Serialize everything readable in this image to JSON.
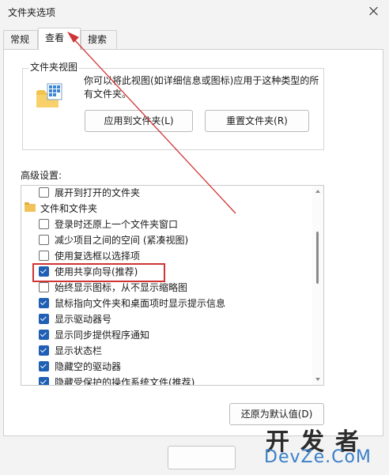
{
  "window": {
    "title": "文件夹选项"
  },
  "tabs": [
    {
      "label": "常规",
      "selected": false
    },
    {
      "label": "查看",
      "selected": true
    },
    {
      "label": "搜索",
      "selected": false
    }
  ],
  "folder_views": {
    "label": "文件夹视图",
    "description": "你可以将此视图(如详细信息或图标)应用于这种类型的所有文件夹。",
    "apply_button": "应用到文件夹(L)",
    "reset_button": "重置文件夹(R)"
  },
  "advanced": {
    "label": "高级设置:",
    "items": [
      {
        "label": "展开到打开的文件夹",
        "type": "checkbox",
        "checked": false
      },
      {
        "label": "文件和文件夹",
        "type": "category"
      },
      {
        "label": "登录时还原上一个文件夹窗口",
        "type": "checkbox",
        "checked": false
      },
      {
        "label": "减少项目之间的空间 (紧凑视图)",
        "type": "checkbox",
        "checked": false
      },
      {
        "label": "使用复选框以选择项",
        "type": "checkbox",
        "checked": false
      },
      {
        "label": "使用共享向导(推荐)",
        "type": "checkbox",
        "checked": true,
        "highlighted": true
      },
      {
        "label": "始终显示图标，从不显示缩略图",
        "type": "checkbox",
        "checked": false
      },
      {
        "label": "鼠标指向文件夹和桌面项时显示提示信息",
        "type": "checkbox",
        "checked": true
      },
      {
        "label": "显示驱动器号",
        "type": "checkbox",
        "checked": true
      },
      {
        "label": "显示同步提供程序通知",
        "type": "checkbox",
        "checked": true
      },
      {
        "label": "显示状态栏",
        "type": "checkbox",
        "checked": true
      },
      {
        "label": "隐藏空的驱动器",
        "type": "checkbox",
        "checked": true
      },
      {
        "label": "隐藏受保护的操作系统文件(推荐)",
        "type": "checkbox",
        "checked": true
      }
    ]
  },
  "restore_defaults_button": "还原为默认值(D)",
  "watermark": {
    "cn": "开发者",
    "en": "DevZe.CoM"
  },
  "colors": {
    "accent": "#1f5fb4",
    "annotation_red": "#d03434",
    "watermark_blue": "#3a7fc7"
  }
}
